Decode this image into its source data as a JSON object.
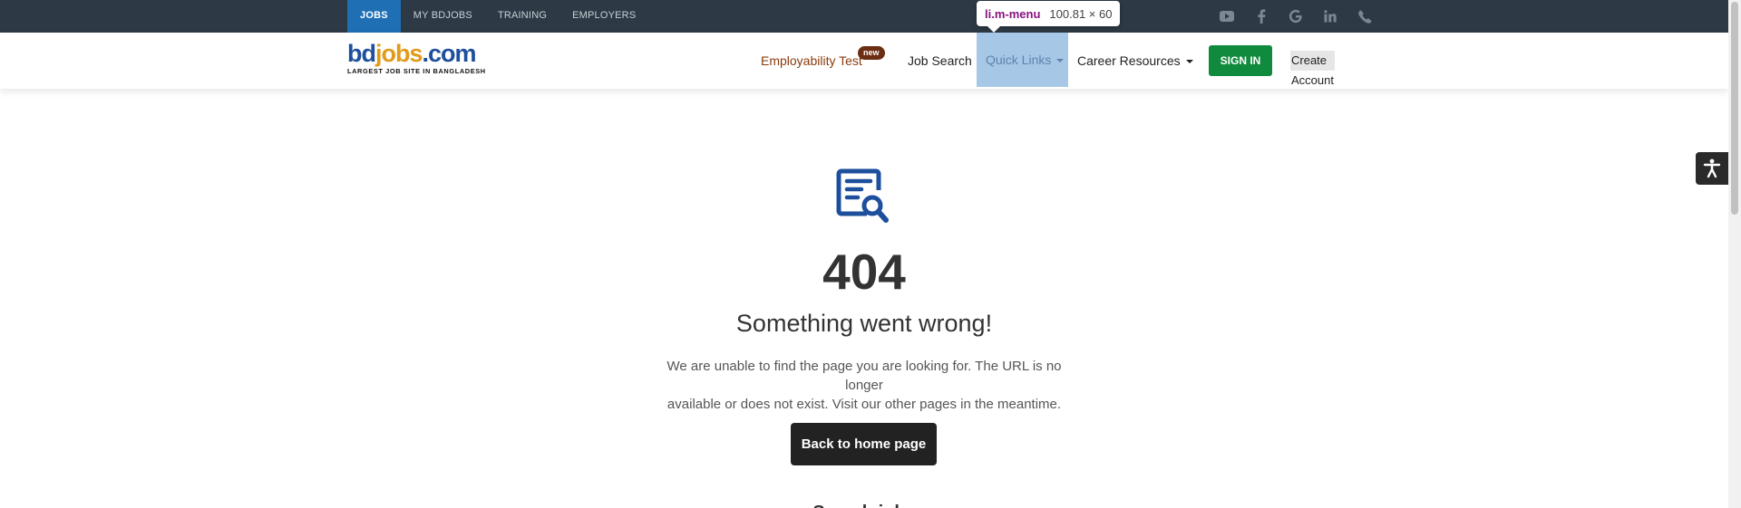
{
  "topbar": {
    "items": [
      {
        "label": "JOBS"
      },
      {
        "label": "MY BDJOBS"
      },
      {
        "label": "TRAINING"
      },
      {
        "label": "EMPLOYERS"
      }
    ],
    "social_icons": [
      "youtube-icon",
      "facebook-icon",
      "google-icon",
      "linkedin-icon",
      "phone-icon"
    ]
  },
  "devtools_tooltip": {
    "selector": "li.m-menu",
    "dimensions": "100.81 × 60"
  },
  "logo": {
    "wordmark_b": "bd",
    "wordmark_j": "jobs",
    "wordmark_c": ".com",
    "tagline": "LARGEST JOB SITE IN BANGLADESH"
  },
  "nav": {
    "employability_test": "Employability Test",
    "new_badge": "new",
    "job_search": "Job Search",
    "quick_links": "Quick Links",
    "career_resources": "Career Resources",
    "sign_in": "SIGN IN",
    "create_account": "Create Account"
  },
  "colors": {
    "topbar_bg": "#2d3a45",
    "active_tab": "#1f6fb5",
    "brand_blue": "#1d4f9c",
    "brand_orange": "#e29a1b",
    "sign_in_green": "#108a3d",
    "quick_links_highlight": "#a6c8e6"
  },
  "error": {
    "icon": "document-search-icon",
    "code": "404",
    "title": "Something went wrong!",
    "message_line1": "We are unable to find the page you are looking for. The URL is no longer",
    "message_line2": "available or does not exist. Visit our other pages in the meantime.",
    "home_button": "Back to home page",
    "next_heading": "Search jobs"
  },
  "accessibility": {
    "icon": "accessibility-icon"
  }
}
